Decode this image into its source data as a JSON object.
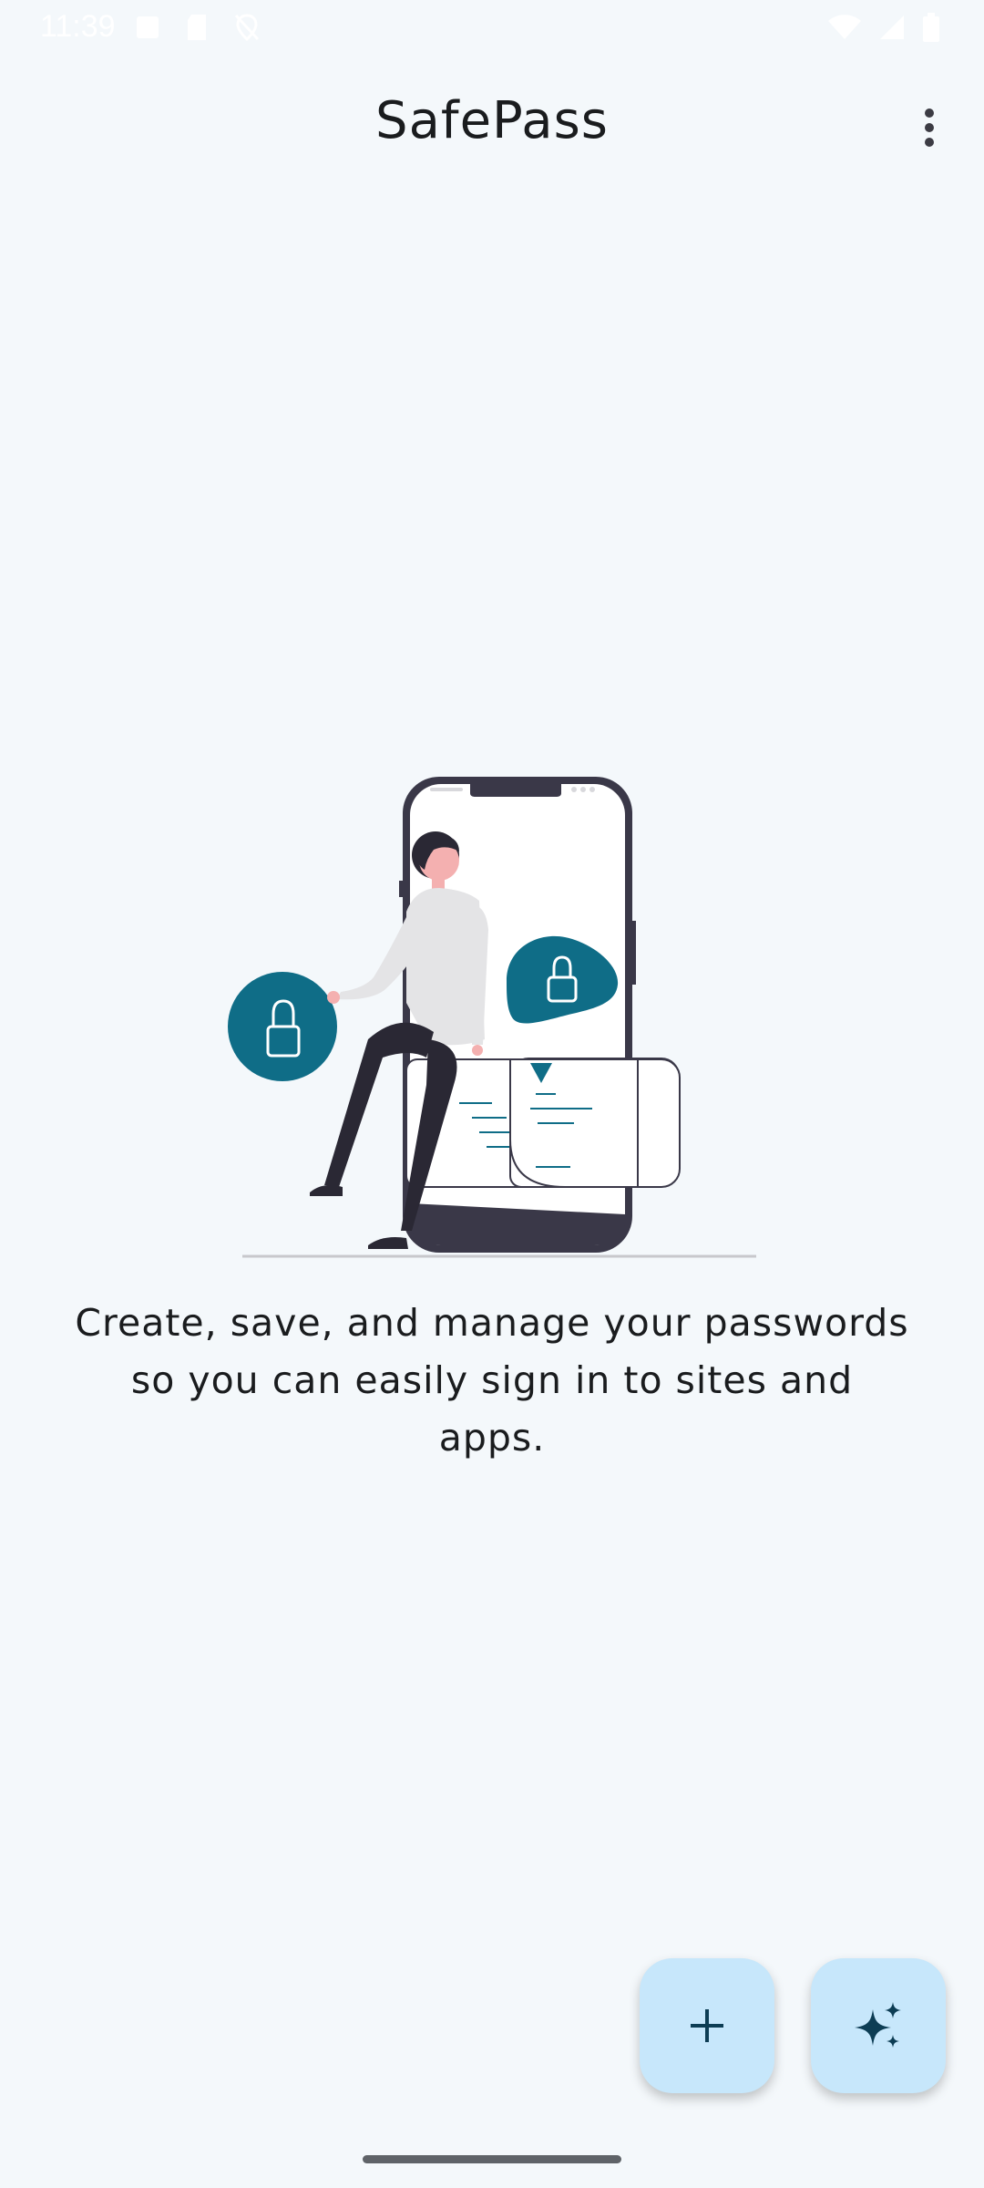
{
  "status_bar": {
    "time": "11:39",
    "left_icons": [
      "autofill-icon",
      "sd-card-icon",
      "location-off-icon"
    ],
    "right_icons": [
      "wifi-icon",
      "signal-icon",
      "battery-icon"
    ]
  },
  "app_bar": {
    "title": "SafePass",
    "menu_icon": "more-vert-icon"
  },
  "empty_state": {
    "illustration": "person-with-phone-and-locks",
    "message": "Create, save, and manage your passwords so you can easily sign in to sites and apps."
  },
  "fabs": {
    "add_icon": "plus-icon",
    "generate_icon": "sparkle-icon"
  },
  "colors": {
    "background": "#f4f8fb",
    "accent_teal": "#0f6d87",
    "fab_bg": "#c7e7fb",
    "fab_icon": "#0d3d54",
    "dark_navy": "#3a3848"
  }
}
